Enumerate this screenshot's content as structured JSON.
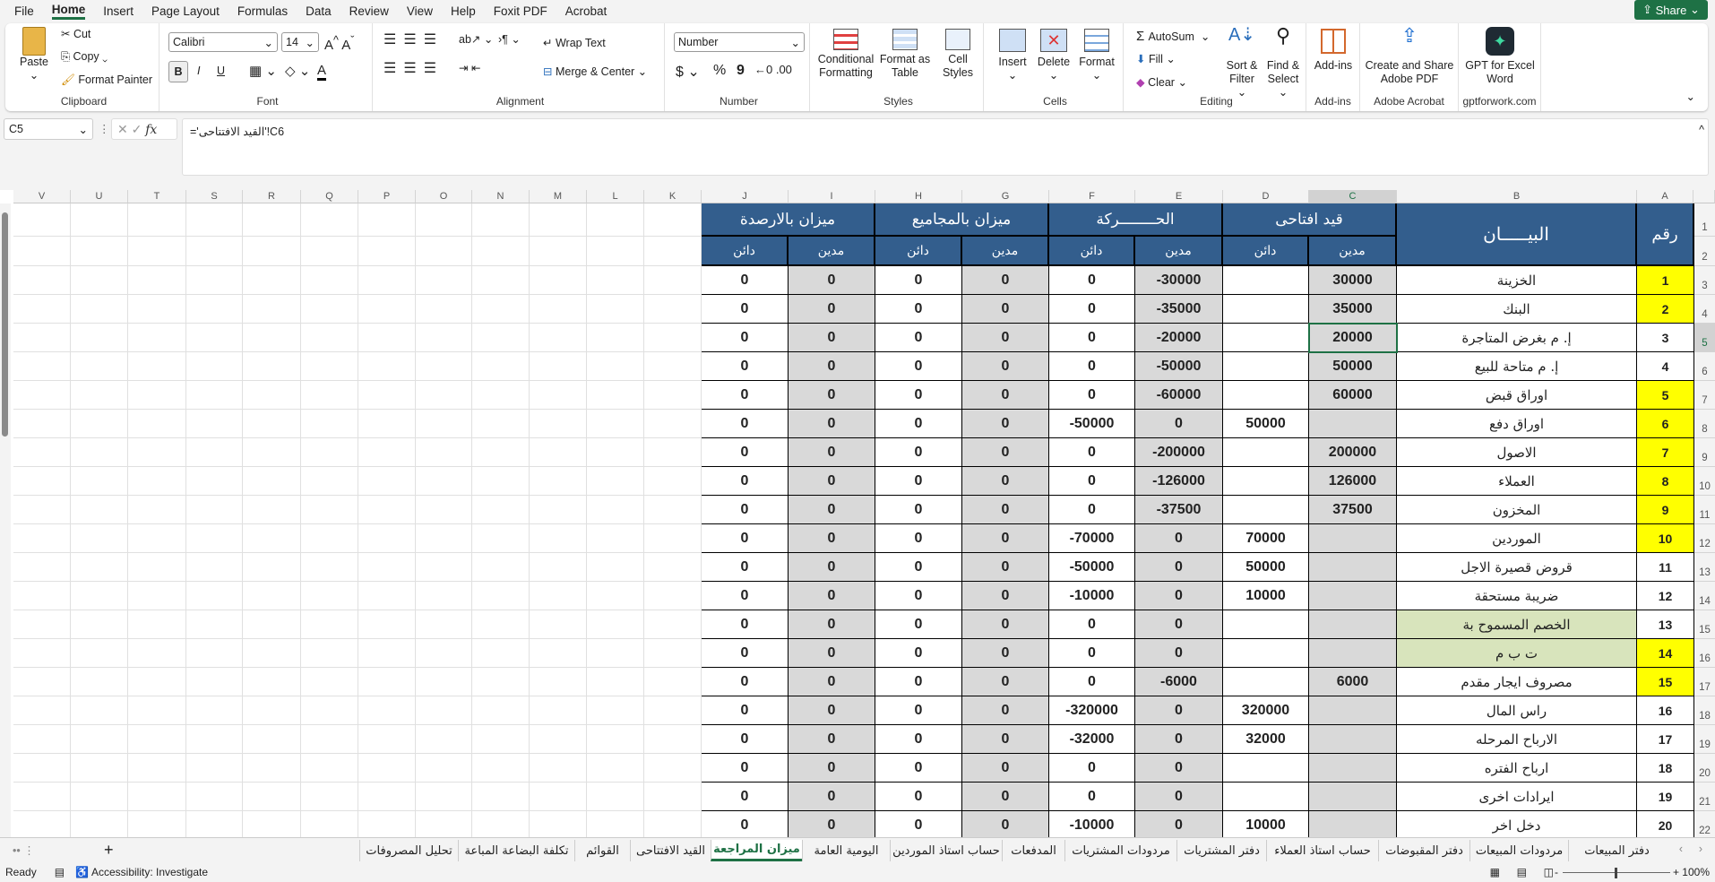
{
  "menu": [
    "File",
    "Home",
    "Insert",
    "Page Layout",
    "Formulas",
    "Data",
    "Review",
    "View",
    "Help",
    "Foxit PDF",
    "Acrobat"
  ],
  "menu_active": "Home",
  "share_label": "Share",
  "ribbon": {
    "clipboard": {
      "label": "Clipboard",
      "paste": "Paste",
      "cut": "Cut",
      "copy": "Copy",
      "format_painter": "Format Painter"
    },
    "font": {
      "label": "Font",
      "font_name": "Calibri",
      "font_size": "14",
      "bold": "B",
      "italic": "I",
      "underline": "U"
    },
    "alignment": {
      "label": "Alignment",
      "wrap_text": "Wrap Text",
      "merge_center": "Merge & Center"
    },
    "number": {
      "label": "Number",
      "format": "Number",
      "currency": "$",
      "percent": "%",
      "comma": "9"
    },
    "styles": {
      "label": "Styles",
      "conditional": "Conditional Formatting",
      "format_table": "Format as Table",
      "cell_styles": "Cell Styles"
    },
    "cells": {
      "label": "Cells",
      "insert": "Insert",
      "delete": "Delete",
      "format": "Format"
    },
    "editing": {
      "label": "Editing",
      "autosum": "AutoSum",
      "fill": "Fill",
      "clear": "Clear",
      "sort_filter": "Sort & Filter",
      "find_select": "Find & Select"
    },
    "addins": {
      "label": "Add-ins",
      "button": "Add-ins"
    },
    "acrobat": {
      "label": "Adobe Acrobat",
      "button": "Create and Share Adobe PDF"
    },
    "gpt": {
      "label": "gptforwork.com",
      "button": "GPT for Excel Word"
    }
  },
  "formula_bar": {
    "name_box": "C5",
    "formula": "='القيد الافتتاحى'!C6"
  },
  "columns": [
    "A",
    "B",
    "C",
    "D",
    "E",
    "F",
    "G",
    "H",
    "I",
    "J",
    "K",
    "L",
    "M",
    "N",
    "O",
    "P",
    "Q",
    "R",
    "S",
    "T",
    "U",
    "V"
  ],
  "selected_column": "C",
  "selected_row": 5,
  "table": {
    "header_num": "رقم",
    "header_label": "البيـــــان",
    "groups": [
      "قيد افتاحى",
      "الحــــــــركة",
      "ميزان بالمجاميع",
      "ميزان بالارصدة"
    ],
    "sub_debit": "مدين",
    "sub_credit": "دائن",
    "colors": {
      "header": "#335e8d",
      "debit_fill": "#d9d9d9",
      "yellow": "#ffff00",
      "green": "#d8e4bc"
    },
    "rows": [
      {
        "num": "1",
        "label": "الخزينة",
        "hl_num": true,
        "hl_label": false,
        "v": [
          "30000",
          "",
          "-30000",
          "0",
          "0",
          "0",
          "0",
          "0"
        ]
      },
      {
        "num": "2",
        "label": "البنك",
        "hl_num": true,
        "hl_label": false,
        "v": [
          "35000",
          "",
          "-35000",
          "0",
          "0",
          "0",
          "0",
          "0"
        ]
      },
      {
        "num": "3",
        "label": "إ. م بغرض المتاجرة",
        "hl_num": false,
        "hl_label": false,
        "v": [
          "20000",
          "",
          "-20000",
          "0",
          "0",
          "0",
          "0",
          "0"
        ]
      },
      {
        "num": "4",
        "label": "إ. م متاحة للبيع",
        "hl_num": false,
        "hl_label": false,
        "v": [
          "50000",
          "",
          "-50000",
          "0",
          "0",
          "0",
          "0",
          "0"
        ]
      },
      {
        "num": "5",
        "label": "اوراق قبض",
        "hl_num": true,
        "hl_label": false,
        "v": [
          "60000",
          "",
          "-60000",
          "0",
          "0",
          "0",
          "0",
          "0"
        ]
      },
      {
        "num": "6",
        "label": "اوراق دفع",
        "hl_num": true,
        "hl_label": false,
        "v": [
          "",
          "50000",
          "0",
          "-50000",
          "0",
          "0",
          "0",
          "0"
        ]
      },
      {
        "num": "7",
        "label": "الاصول",
        "hl_num": true,
        "hl_label": false,
        "v": [
          "200000",
          "",
          "-200000",
          "0",
          "0",
          "0",
          "0",
          "0"
        ]
      },
      {
        "num": "8",
        "label": "العملاء",
        "hl_num": true,
        "hl_label": false,
        "v": [
          "126000",
          "",
          "-126000",
          "0",
          "0",
          "0",
          "0",
          "0"
        ]
      },
      {
        "num": "9",
        "label": "المخزون",
        "hl_num": true,
        "hl_label": false,
        "v": [
          "37500",
          "",
          "-37500",
          "0",
          "0",
          "0",
          "0",
          "0"
        ]
      },
      {
        "num": "10",
        "label": "الموردين",
        "hl_num": true,
        "hl_label": false,
        "v": [
          "",
          "70000",
          "0",
          "-70000",
          "0",
          "0",
          "0",
          "0"
        ]
      },
      {
        "num": "11",
        "label": "قروض قصيرة الاجل",
        "hl_num": false,
        "hl_label": false,
        "v": [
          "",
          "50000",
          "0",
          "-50000",
          "0",
          "0",
          "0",
          "0"
        ]
      },
      {
        "num": "12",
        "label": "ضريبة مستحقة",
        "hl_num": false,
        "hl_label": false,
        "v": [
          "",
          "10000",
          "0",
          "-10000",
          "0",
          "0",
          "0",
          "0"
        ]
      },
      {
        "num": "13",
        "label": "الخصم المسموح بة",
        "hl_num": false,
        "hl_label": true,
        "v": [
          "",
          "",
          "0",
          "0",
          "0",
          "0",
          "0",
          "0"
        ]
      },
      {
        "num": "14",
        "label": "ت ب م",
        "hl_num": true,
        "hl_label": true,
        "v": [
          "",
          "",
          "0",
          "0",
          "0",
          "0",
          "0",
          "0"
        ]
      },
      {
        "num": "15",
        "label": "مصروف ايجار مقدم",
        "hl_num": true,
        "hl_label": false,
        "v": [
          "6000",
          "",
          "-6000",
          "0",
          "0",
          "0",
          "0",
          "0"
        ]
      },
      {
        "num": "16",
        "label": "راس المال",
        "hl_num": false,
        "hl_label": false,
        "v": [
          "",
          "320000",
          "0",
          "-320000",
          "0",
          "0",
          "0",
          "0"
        ]
      },
      {
        "num": "17",
        "label": "الارباح المرحله",
        "hl_num": false,
        "hl_label": false,
        "v": [
          "",
          "32000",
          "0",
          "-32000",
          "0",
          "0",
          "0",
          "0"
        ]
      },
      {
        "num": "18",
        "label": "ارباح الفتره",
        "hl_num": false,
        "hl_label": false,
        "v": [
          "",
          "",
          "0",
          "0",
          "0",
          "0",
          "0",
          "0"
        ]
      },
      {
        "num": "19",
        "label": "ايرادات اخرى",
        "hl_num": false,
        "hl_label": false,
        "v": [
          "",
          "",
          "0",
          "0",
          "0",
          "0",
          "0",
          "0"
        ]
      },
      {
        "num": "20",
        "label": "دخل اخر",
        "hl_num": false,
        "hl_label": false,
        "v": [
          "",
          "10000",
          "0",
          "-10000",
          "0",
          "0",
          "0",
          "0"
        ]
      }
    ]
  },
  "sheet_tabs": [
    "دفتر المبيعات",
    "مردودات المبيعات",
    "دفتر المقبوضات",
    "حساب استاذ العملاء",
    "دفتر المشتريات",
    "مردودات المشتريات",
    "المدفعات",
    "حساب استاذ الموردين",
    "اليومية العامة",
    "ميزان المراجعة",
    "القيد الافتتاحى",
    "القوائم",
    "تكلفة البضاعة المباعة",
    "تحليل المصروفات"
  ],
  "active_tab": "ميزان المراجعة",
  "status": {
    "ready": "Ready",
    "accessibility": "Accessibility: Investigate",
    "zoom": "100%"
  }
}
